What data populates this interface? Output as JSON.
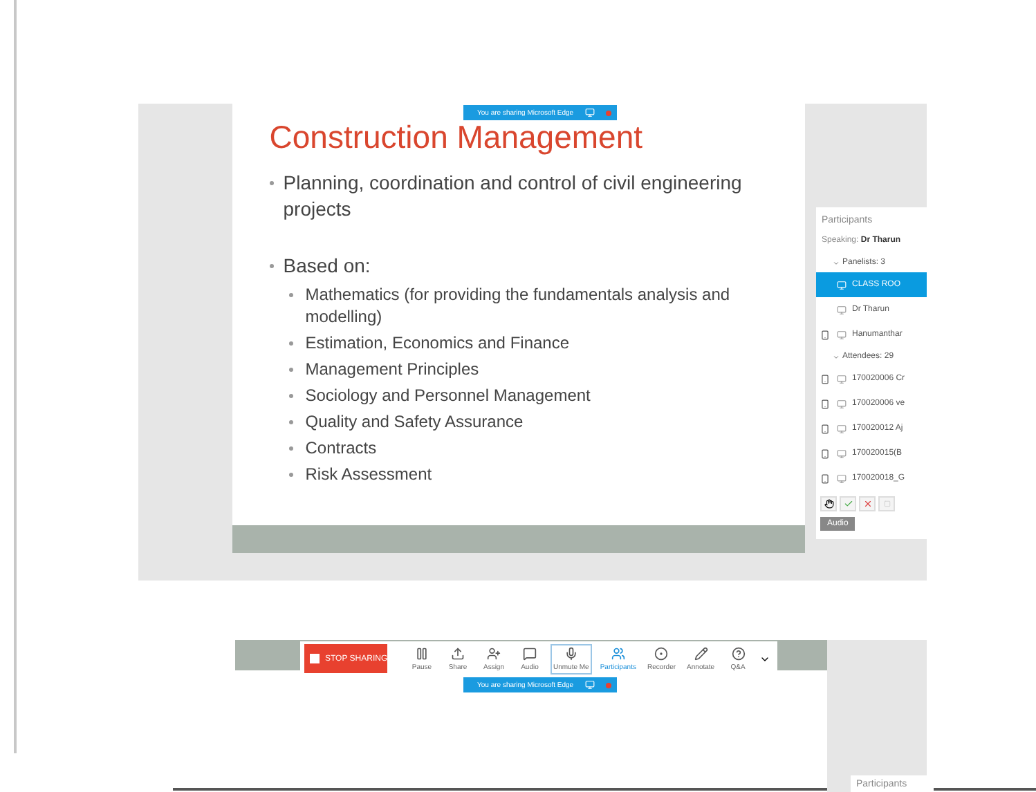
{
  "slide": {
    "title": "Construction Management",
    "bullets": [
      {
        "text": "Planning, coordination and control of civil engineering projects"
      },
      {
        "text": "Based on:",
        "children": [
          {
            "text": "Mathematics (for providing the fundamentals analysis and modelling)"
          },
          {
            "text": "Estimation, Economics and Finance"
          },
          {
            "text": "Management Principles"
          },
          {
            "text": "Sociology and Personnel Management"
          },
          {
            "text": "Quality and Safety Assurance"
          },
          {
            "text": "Contracts"
          },
          {
            "text": "Risk Assessment"
          }
        ]
      }
    ]
  },
  "share_banner_top": {
    "text": "You are sharing Microsoft Edge"
  },
  "participants": {
    "title": "Participants",
    "speaking_label": "Speaking:",
    "speaking_name": "Dr Tharun",
    "groups": [
      {
        "label": "Panelists: 3",
        "expanded": true,
        "rows": [
          {
            "name": "CLASS ROO",
            "selected": true,
            "phone": false
          },
          {
            "name": "Dr Tharun",
            "selected": false,
            "phone": false
          },
          {
            "name": "Hanumanthar",
            "selected": false,
            "phone": true
          }
        ]
      },
      {
        "label": "Attendees: 29",
        "expanded": true,
        "rows": [
          {
            "name": "170020006 Cr",
            "selected": false,
            "phone": true
          },
          {
            "name": "170020006 ve",
            "selected": false,
            "phone": true
          },
          {
            "name": "170020012 Aj",
            "selected": false,
            "phone": true
          },
          {
            "name": "170020015(B",
            "selected": false,
            "phone": true
          },
          {
            "name": "170020018_G",
            "selected": false,
            "phone": true
          }
        ]
      }
    ],
    "audio_button": "Audio"
  },
  "toolbar": {
    "stop_label": "STOP SHARING",
    "items": [
      {
        "label": "Pause",
        "selected": false,
        "on": false
      },
      {
        "label": "Share",
        "selected": false,
        "on": false
      },
      {
        "label": "Assign",
        "selected": false,
        "on": false
      },
      {
        "label": "Audio",
        "selected": false,
        "on": false
      },
      {
        "label": "Unmute Me",
        "selected": true,
        "on": false
      },
      {
        "label": "Participants",
        "selected": false,
        "on": true
      },
      {
        "label": "Recorder",
        "selected": false,
        "on": false
      },
      {
        "label": "Annotate",
        "selected": false,
        "on": false
      },
      {
        "label": "Q&A",
        "selected": false,
        "on": false
      }
    ]
  },
  "share_banner_bottom": {
    "text": "You are sharing Microsoft Edge"
  },
  "participants_bottom": {
    "title": "Participants"
  }
}
